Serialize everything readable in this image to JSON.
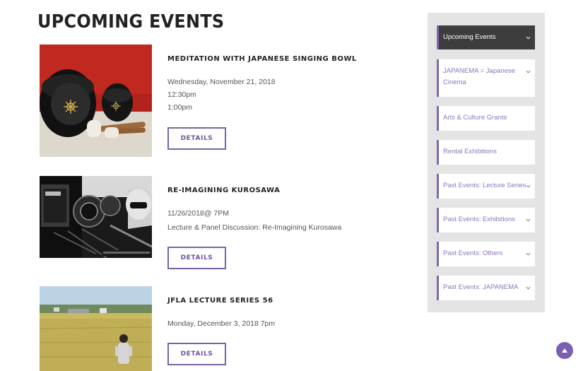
{
  "page": {
    "title": "UPCOMING EVENTS"
  },
  "events": [
    {
      "title": "MEDITATION WITH JAPANESE SINGING BOWL",
      "lines": [
        "Wednesday, November 21, 2018",
        "12:30pm",
        "1:00pm"
      ],
      "button": "DETAILS",
      "image_alt": "singing-bowl-photo"
    },
    {
      "title": "RE-IMAGINING KUROSAWA",
      "lines": [
        "11/26/2018@ 7PM",
        "Lecture & Panel Discussion: Re-Imagining Kurosawa"
      ],
      "button": "DETAILS",
      "image_alt": "kurosawa-camera-photo"
    },
    {
      "title": "JFLA LECTURE SERIES 56",
      "lines": [
        "Monday, December 3, 2018 7pm"
      ],
      "button": "DETAILS",
      "image_alt": "rice-field-photo"
    }
  ],
  "sidebar": {
    "items": [
      {
        "label": "Upcoming Events",
        "chevron": true,
        "active": true
      },
      {
        "label": "JAPANEMA = Japanese Cinema",
        "chevron": true,
        "active": false
      },
      {
        "label": "Arts & Culture Grants",
        "chevron": false,
        "active": false
      },
      {
        "label": "Rental Exhibitions",
        "chevron": false,
        "active": false
      },
      {
        "label": "Past Events: Lecture Series",
        "chevron": true,
        "active": false
      },
      {
        "label": "Past Events: Exhibitions",
        "chevron": true,
        "active": false
      },
      {
        "label": "Past Events: Others",
        "chevron": true,
        "active": false
      },
      {
        "label": "Past Events: JAPANEMA",
        "chevron": true,
        "active": false
      }
    ]
  },
  "colors": {
    "accent": "#7a62a8",
    "active_bg": "#3d3d3d",
    "sidebar_bg": "#e4e4e4"
  },
  "icons": {
    "chevron": "chevron-down-icon",
    "scroll_top": "arrow-up-icon"
  }
}
